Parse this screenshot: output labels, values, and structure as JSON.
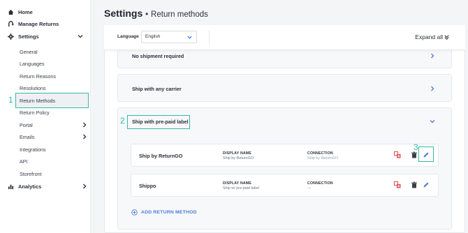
{
  "sidebar": {
    "home": "Home",
    "manage_returns": "Manage Returns",
    "settings": "Settings",
    "sub_items": [
      "General",
      "Languages",
      "Return Reasons",
      "Resolutions",
      "Return Methods",
      "Return Policy",
      "Portal",
      "Emails",
      "Integrations",
      "API",
      "Storefront"
    ],
    "analytics": "Analytics"
  },
  "steps": [
    "1",
    "2",
    "3"
  ],
  "header": {
    "title": "Settings",
    "separator": "•",
    "subtitle": "Return methods"
  },
  "toolbar": {
    "language_label": "Language",
    "language_value": "English",
    "expand_all": "Expand all"
  },
  "sections": [
    {
      "title": "No shipment required"
    },
    {
      "title": "Ship with any carrier"
    },
    {
      "title": "Ship with pre-paid label"
    }
  ],
  "methods": [
    {
      "name": "Ship by ReturnGO",
      "display_name_label": "DISPLAY NAME",
      "display_name": "Ship by ReturnGO",
      "connection_label": "CONNECTION",
      "connection": "Ship by ReturnGO"
    },
    {
      "name": "Shippo",
      "display_name_label": "DISPLAY NAME",
      "display_name": "Ship w/ pre-paid label",
      "connection_label": "CONNECTION",
      "connection": "---"
    }
  ],
  "add_method": "ADD RETURN METHOD",
  "colors": {
    "accent": "#33b9a8",
    "link": "#4a7bd6",
    "danger": "#e5484d"
  }
}
